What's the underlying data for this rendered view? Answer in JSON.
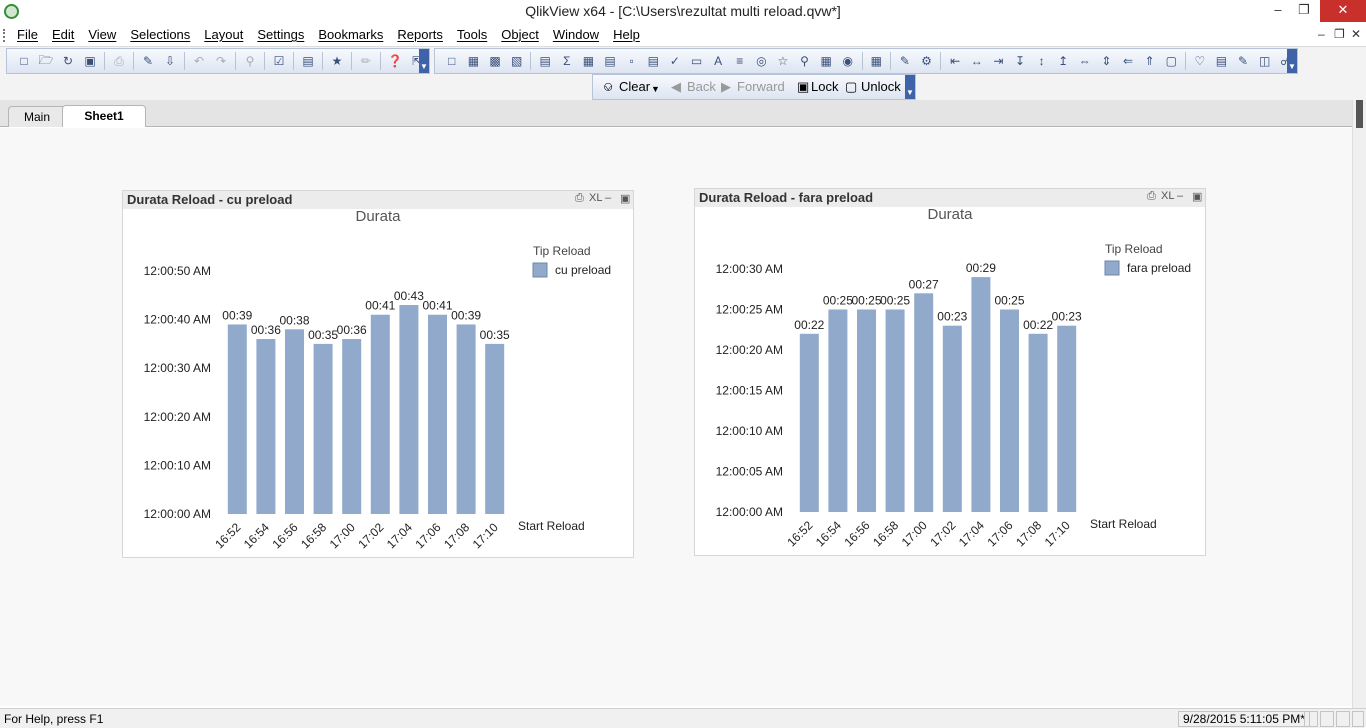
{
  "window": {
    "title": "QlikView x64 - [C:\\Users\\rezultat multi reload.qvw*]",
    "minimize": "–",
    "restore": "❐",
    "close": "✕",
    "mdi_minimize": "–",
    "mdi_restore": "❐",
    "mdi_close": "✕"
  },
  "menu": {
    "items": [
      {
        "label": "File"
      },
      {
        "label": "Edit"
      },
      {
        "label": "View"
      },
      {
        "label": "Selections"
      },
      {
        "label": "Layout"
      },
      {
        "label": "Settings"
      },
      {
        "label": "Bookmarks"
      },
      {
        "label": "Reports"
      },
      {
        "label": "Tools"
      },
      {
        "label": "Object"
      },
      {
        "label": "Window"
      },
      {
        "label": "Help"
      }
    ]
  },
  "selection_bar": {
    "clear": "Clear",
    "back": "Back",
    "forward": "Forward",
    "lock": "Lock",
    "unlock": "Unlock"
  },
  "tabs": [
    {
      "label": "Main",
      "active": false
    },
    {
      "label": "Sheet1",
      "active": true
    }
  ],
  "status": {
    "help": "For Help, press F1",
    "datetime": "9/28/2015 5:11:05 PM*"
  },
  "colors": {
    "bar": "#91a9ca",
    "grid": "#e6e6e6"
  },
  "chart_data": [
    {
      "type": "bar",
      "caption": "Durata Reload - cu preload",
      "caption_icons": {
        "print": "⎙",
        "xl": "XL",
        "minimize": "–",
        "maximize": "▣"
      },
      "title": "Durata",
      "xlabel": "Start Reload",
      "ylabel": "",
      "legend": {
        "title": "Tip Reload",
        "placement": "top-right"
      },
      "categories": [
        "16:52",
        "16:54",
        "16:56",
        "16:58",
        "17:00",
        "17:02",
        "17:04",
        "17:06",
        "17:08",
        "17:10"
      ],
      "series": [
        {
          "name": "cu preload",
          "values": [
            39,
            36,
            38,
            35,
            36,
            41,
            43,
            41,
            39,
            35
          ],
          "labels": [
            "00:39",
            "00:36",
            "00:38",
            "00:35",
            "00:36",
            "00:41",
            "00:43",
            "00:41",
            "00:39",
            "00:35"
          ]
        }
      ],
      "yticks": [
        {
          "value": 0,
          "label": "12:00:00 AM"
        },
        {
          "value": 10,
          "label": "12:00:10 AM"
        },
        {
          "value": 20,
          "label": "12:00:20 AM"
        },
        {
          "value": 30,
          "label": "12:00:30 AM"
        },
        {
          "value": 40,
          "label": "12:00:40 AM"
        },
        {
          "value": 50,
          "label": "12:00:50 AM"
        }
      ],
      "ylim": [
        0,
        50
      ]
    },
    {
      "type": "bar",
      "caption": "Durata Reload - fara preload",
      "caption_icons": {
        "print": "⎙",
        "xl": "XL",
        "minimize": "–",
        "maximize": "▣"
      },
      "title": "Durata",
      "xlabel": "Start Reload",
      "ylabel": "",
      "legend": {
        "title": "Tip Reload",
        "placement": "top-right"
      },
      "categories": [
        "16:52",
        "16:54",
        "16:56",
        "16:58",
        "17:00",
        "17:02",
        "17:04",
        "17:06",
        "17:08",
        "17:10"
      ],
      "series": [
        {
          "name": "fara preload",
          "values": [
            22,
            25,
            25,
            25,
            27,
            23,
            29,
            25,
            22,
            23
          ],
          "labels": [
            "00:22",
            "00:25",
            "00:25",
            "00:25",
            "00:27",
            "00:23",
            "00:29",
            "00:25",
            "00:22",
            "00:23"
          ]
        }
      ],
      "yticks": [
        {
          "value": 0,
          "label": "12:00:00 AM"
        },
        {
          "value": 5,
          "label": "12:00:05 AM"
        },
        {
          "value": 10,
          "label": "12:00:10 AM"
        },
        {
          "value": 15,
          "label": "12:00:15 AM"
        },
        {
          "value": 20,
          "label": "12:00:20 AM"
        },
        {
          "value": 25,
          "label": "12:00:25 AM"
        },
        {
          "value": 30,
          "label": "12:00:30 AM"
        }
      ],
      "ylim": [
        0,
        30
      ]
    }
  ]
}
